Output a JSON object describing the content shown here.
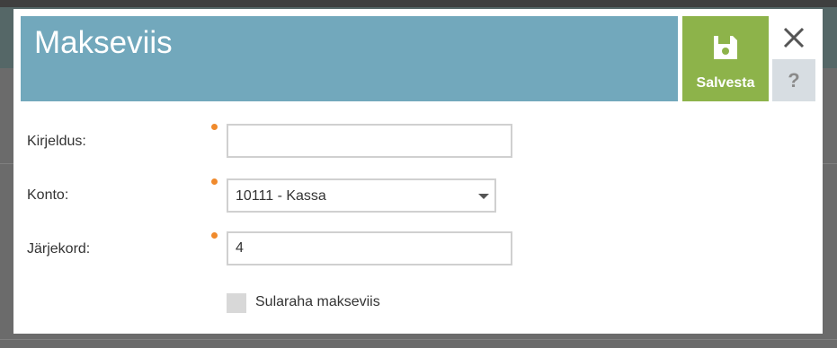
{
  "dialog": {
    "title": "Makseviis",
    "save_label": "Salvesta",
    "help_label": "?"
  },
  "form": {
    "description": {
      "label": "Kirjeldus:",
      "value": ""
    },
    "account": {
      "label": "Konto:",
      "selected": "10111 - Kassa"
    },
    "order": {
      "label": "Järjekord:",
      "value": "4"
    },
    "cash_checkbox": {
      "label": "Sularaha makseviis",
      "checked": false
    }
  },
  "colors": {
    "title_bar": "#72a8bc",
    "save_button": "#8db34a",
    "required_dot": "#f08a2c",
    "help_button": "#d7dde2"
  },
  "icons": {
    "save": "floppy-disk",
    "close": "x-cross",
    "dropdown": "caret-down"
  }
}
